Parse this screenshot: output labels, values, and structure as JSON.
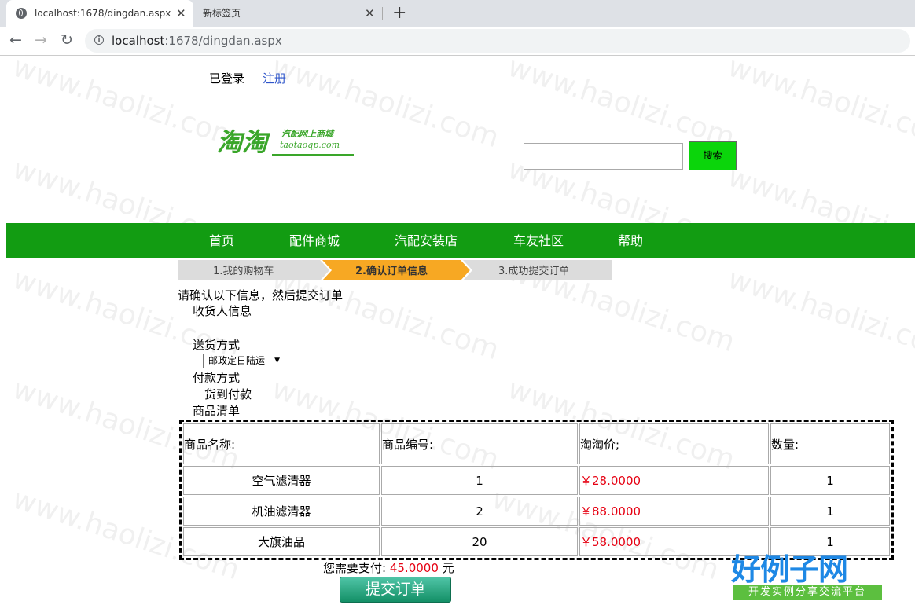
{
  "browser": {
    "active_tab_title": "localhost:1678/dingdan.aspx",
    "inactive_tab_title": "新标签页",
    "url_host": "localhost",
    "url_path": ":1678/dingdan.aspx"
  },
  "header": {
    "logged_in": "已登录",
    "register": "注册",
    "logo_main": "淘淘",
    "logo_tagline": "汽配网上商城",
    "logo_domain": "taotaoqp.com",
    "search_placeholder": "",
    "search_button": "搜索"
  },
  "nav": [
    "首页",
    "配件商城",
    "汽配安装店",
    "车友社区",
    "帮助"
  ],
  "steps": [
    "1.我的购物车",
    "2.确认订单信息",
    "3.成功提交订单"
  ],
  "order": {
    "prompt": "请确认以下信息，然后提交订单",
    "receiver_label": "收货人信息",
    "shipping_label": "送货方式",
    "shipping_selected": "邮政定日陆运",
    "payment_label": "付款方式",
    "payment_value": "货到付款",
    "items_label": "商品清单",
    "columns": [
      "商品名称:",
      "商品编号:",
      "淘淘价;",
      "数量:"
    ],
    "rows": [
      {
        "name": "空气滤清器",
        "id": "1",
        "price": "￥28.0000",
        "qty": "1"
      },
      {
        "name": "机油滤清器",
        "id": "2",
        "price": "￥88.0000",
        "qty": "1"
      },
      {
        "name": "大旗油品",
        "id": "20",
        "price": "￥58.0000",
        "qty": "1"
      }
    ],
    "total_label": "您需要支付:",
    "total_value": "45.0000",
    "total_unit": "元",
    "submit": "提交订单"
  },
  "watermark": {
    "text": "www.haolizi.com",
    "brand_big": "好例子网",
    "brand_small": "开发实例分享交流平台"
  },
  "colors": {
    "nav_green": "#129c12",
    "search_green": "#0bd50b",
    "step_active": "#f7a823",
    "price_red": "#e60012"
  }
}
